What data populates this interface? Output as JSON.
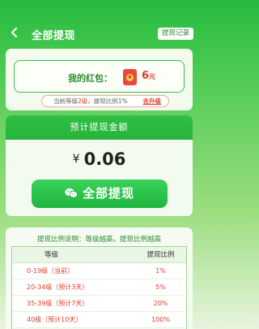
{
  "header": {
    "title": "全部提现",
    "record_label": "提现记录"
  },
  "hongbao": {
    "label": "我的红包：",
    "amount": "6",
    "unit": "元",
    "level_prefix": "当前等级",
    "level_value": "2级",
    "ratio_text": "，提现比例1%",
    "upgrade_label": "去升级"
  },
  "withdraw": {
    "heading": "预计提现金额",
    "currency_symbol": "¥",
    "amount": "0.06",
    "button_label": "全部提现"
  },
  "ratio": {
    "title": "提现比例说明：等级越高，提现比例越高",
    "columns": [
      "等级",
      "提现比例"
    ],
    "rows": [
      {
        "level": "0-19级（当前）",
        "ratio": "1%"
      },
      {
        "level": "20-34级（预计3天）",
        "ratio": "5%"
      },
      {
        "level": "35-39级（预计7天）",
        "ratio": "20%"
      },
      {
        "level": "40级（预计10天）",
        "ratio": "100%"
      }
    ]
  },
  "colors": {
    "brand_green": "#28b93f",
    "accent_red": "#e23c2c"
  }
}
